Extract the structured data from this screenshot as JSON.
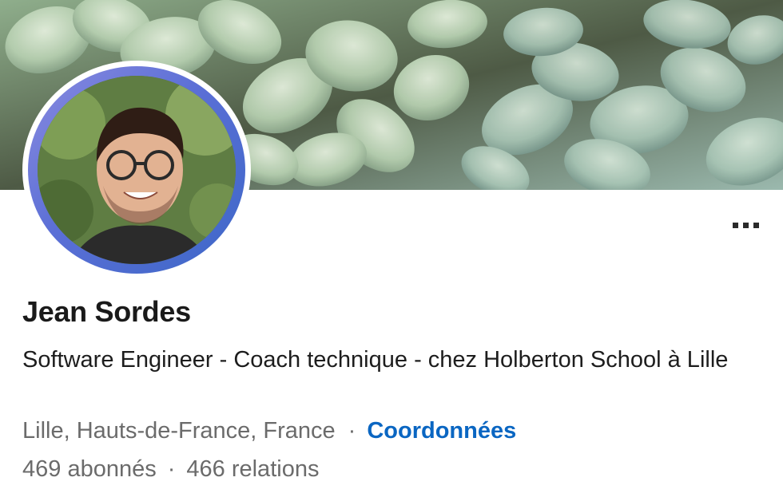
{
  "profile": {
    "name": "Jean Sordes",
    "headline": "Software Engineer - Coach technique - chez Holberton School à Lille",
    "location": "Lille, Hauts-de-France, France",
    "separator": "·",
    "contact_link": "Coordonnées",
    "followers": "469 abonnés",
    "connections": "466 relations"
  },
  "icons": {
    "more": "more-options-icon"
  },
  "colors": {
    "link": "#0a66c2",
    "secondary_text": "#6b6b6b",
    "ring_gradient_start": "#8a8be0",
    "ring_gradient_end": "#3c67c7"
  }
}
